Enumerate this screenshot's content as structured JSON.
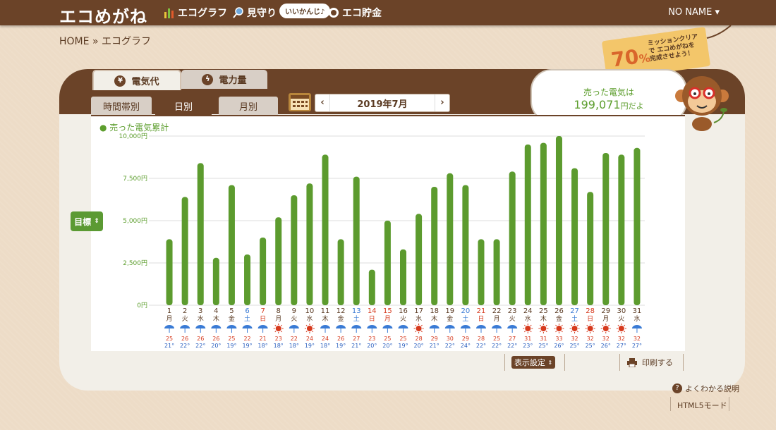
{
  "app": {
    "logo": "エコめがね",
    "user": "NO NAME ▾"
  },
  "nav": {
    "graph": "エコグラフ",
    "watch": "見守り",
    "watch_bubble": "いいかんじ♪",
    "saving": "エコ貯金"
  },
  "breadcrumb": {
    "home": "HOME",
    "sep": "»",
    "current": "エコグラフ"
  },
  "tabs": {
    "electric_cost": "電気代",
    "electric_power": "電力量",
    "hourly": "時間帯別",
    "daily": "日別",
    "monthly": "月別"
  },
  "month": {
    "label": "2019年7月",
    "prev": "‹",
    "next": "›"
  },
  "mission": {
    "percent": "70",
    "unit": "%",
    "text": "ミッションクリアで エコめがねを 完成させよう！"
  },
  "sold": {
    "label": "売った電気は",
    "amount": "199,071",
    "unit": "円だよ"
  },
  "controls": {
    "goal": "目標",
    "display_settings": "表示設定",
    "print": "印刷する"
  },
  "footer": {
    "help": "よくわかる説明",
    "html5": "HTML5モード"
  },
  "colors": {
    "bar": "#5c9b2e",
    "header": "#6b4328",
    "grid": "#dddddd",
    "sun": "#d63a1e",
    "rain": "#3a7bd5",
    "high": "#d63a1e",
    "low": "#2a5fbf"
  },
  "chart_data": {
    "type": "bar",
    "legend": "売った電気累計",
    "ylim": [
      0,
      10000
    ],
    "yticks": [
      "0円",
      "2,500円",
      "5,000円",
      "7,500円",
      "10,000円"
    ],
    "ytick_values": [
      0,
      2500,
      5000,
      7500,
      10000
    ],
    "categories": [
      "1",
      "2",
      "3",
      "4",
      "5",
      "6",
      "7",
      "8",
      "9",
      "10",
      "11",
      "12",
      "13",
      "14",
      "15",
      "16",
      "17",
      "18",
      "19",
      "20",
      "21",
      "22",
      "23",
      "24",
      "25",
      "26",
      "27",
      "28",
      "29",
      "30",
      "31"
    ],
    "weekdays": [
      "月",
      "火",
      "水",
      "木",
      "金",
      "土",
      "日",
      "月",
      "火",
      "水",
      "木",
      "金",
      "土",
      "日",
      "月",
      "火",
      "水",
      "木",
      "金",
      "土",
      "日",
      "月",
      "火",
      "水",
      "木",
      "金",
      "土",
      "日",
      "月",
      "火",
      "水"
    ],
    "values": [
      3900,
      6400,
      8400,
      2800,
      7100,
      3000,
      4000,
      5200,
      6500,
      7200,
      8900,
      3900,
      7600,
      2100,
      5000,
      3300,
      5400,
      7000,
      7800,
      7100,
      3900,
      3900,
      7900,
      9500,
      9600,
      10000,
      8100,
      6700,
      9000,
      8900,
      9300
    ],
    "weather": [
      "rain",
      "rain",
      "rain",
      "rain",
      "rain",
      "rain",
      "rain",
      "sun",
      "rain",
      "sun",
      "rain",
      "rain",
      "rain",
      "rain",
      "rain",
      "rain",
      "sun",
      "rain",
      "rain",
      "rain",
      "rain",
      "rain",
      "rain",
      "sun",
      "sun",
      "sun",
      "sun",
      "sun",
      "sun",
      "sun",
      "rain"
    ],
    "high": [
      "25",
      "26",
      "26",
      "26",
      "25",
      "22",
      "21",
      "23",
      "22",
      "24",
      "24",
      "26",
      "27",
      "23",
      "25",
      "25",
      "28",
      "29",
      "30",
      "29",
      "28",
      "25",
      "27",
      "31",
      "31",
      "33",
      "32",
      "32",
      "32",
      "32",
      "32"
    ],
    "low": [
      "21",
      "22",
      "22",
      "20",
      "19",
      "19",
      "18",
      "18",
      "18",
      "19",
      "18",
      "19",
      "21",
      "20",
      "20",
      "19",
      "20",
      "21",
      "22",
      "24",
      "22",
      "22",
      "22",
      "23",
      "25",
      "26",
      "25",
      "25",
      "26",
      "27",
      "27"
    ],
    "unit": "℃"
  }
}
